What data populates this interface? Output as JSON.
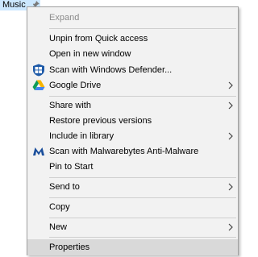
{
  "folder": {
    "name": "Music",
    "pin_icon": "pin-icon"
  },
  "menu": {
    "items": [
      {
        "label": "Expand",
        "disabled": true
      },
      {
        "label": "Unpin from Quick access"
      },
      {
        "label": "Open in new window"
      },
      {
        "label": "Scan with Windows Defender...",
        "icon": "windows-defender-icon"
      },
      {
        "label": "Google Drive",
        "icon": "google-drive-icon",
        "submenu": true
      },
      {
        "label": "Share with",
        "submenu": true
      },
      {
        "label": "Restore previous versions"
      },
      {
        "label": "Include in library",
        "submenu": true
      },
      {
        "label": "Scan with Malwarebytes Anti-Malware",
        "icon": "malwarebytes-icon"
      },
      {
        "label": "Pin to Start"
      },
      {
        "label": "Send to",
        "submenu": true
      },
      {
        "label": "Copy"
      },
      {
        "label": "New",
        "submenu": true
      },
      {
        "label": "Properties",
        "highlighted": true
      }
    ]
  },
  "colors": {
    "menu_background": "#f2f2f2",
    "highlight": "#d9d9d9",
    "selection": "#cce8ff",
    "defender_blue": "#1e5aa8",
    "malwarebytes_blue": "#1b4f9c"
  }
}
